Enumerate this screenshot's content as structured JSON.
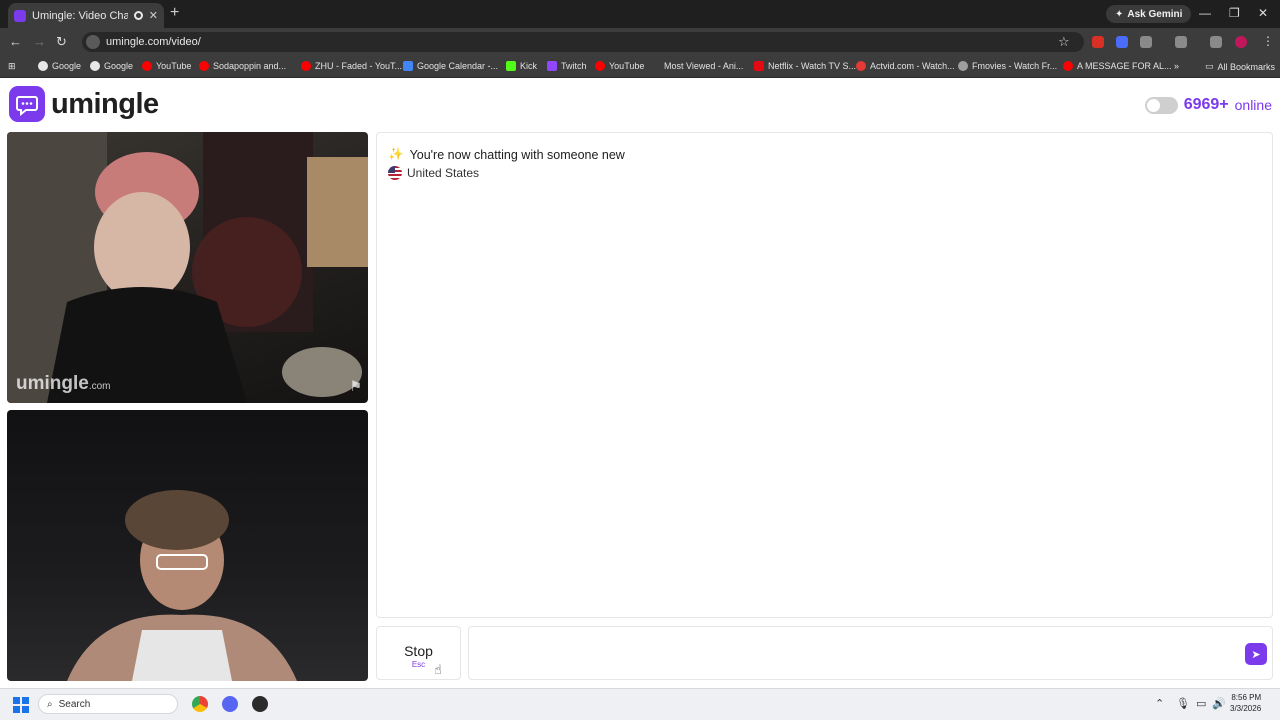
{
  "browser": {
    "tab_title": "Umingle: Video Chat with S",
    "url": "umingle.com/video/",
    "gemini_label": "Ask Gemini",
    "bookmarks": [
      "Google",
      "Google",
      "YouTube",
      "Sodapoppin and...",
      "ZHU - Faded - YouT...",
      "Google Calendar -...",
      "Kick",
      "Twitch",
      "YouTube",
      "Most Viewed - Ani...",
      "Netflix - Watch TV S...",
      "Actvid.com - Watch...",
      "Fmovies - Watch Fr...",
      "A MESSAGE FOR AL..."
    ],
    "all_bookmarks": "All Bookmarks"
  },
  "header": {
    "logo": "umingle",
    "online_count": "6969+",
    "online_label": "online"
  },
  "video": {
    "watermark": "umingle",
    "watermark_suffix": ".com"
  },
  "chat": {
    "status_message": "You're now chatting with someone new",
    "country": "United States"
  },
  "controls": {
    "stop_label": "Stop",
    "stop_key": "Esc",
    "input_value": "",
    "input_placeholder": ""
  },
  "taskbar": {
    "search_label": "Search",
    "time": "8:56 PM",
    "date": "3/3/2026"
  },
  "colors": {
    "accent": "#7c3aed",
    "chrome_dark": "#3c3c3c"
  }
}
